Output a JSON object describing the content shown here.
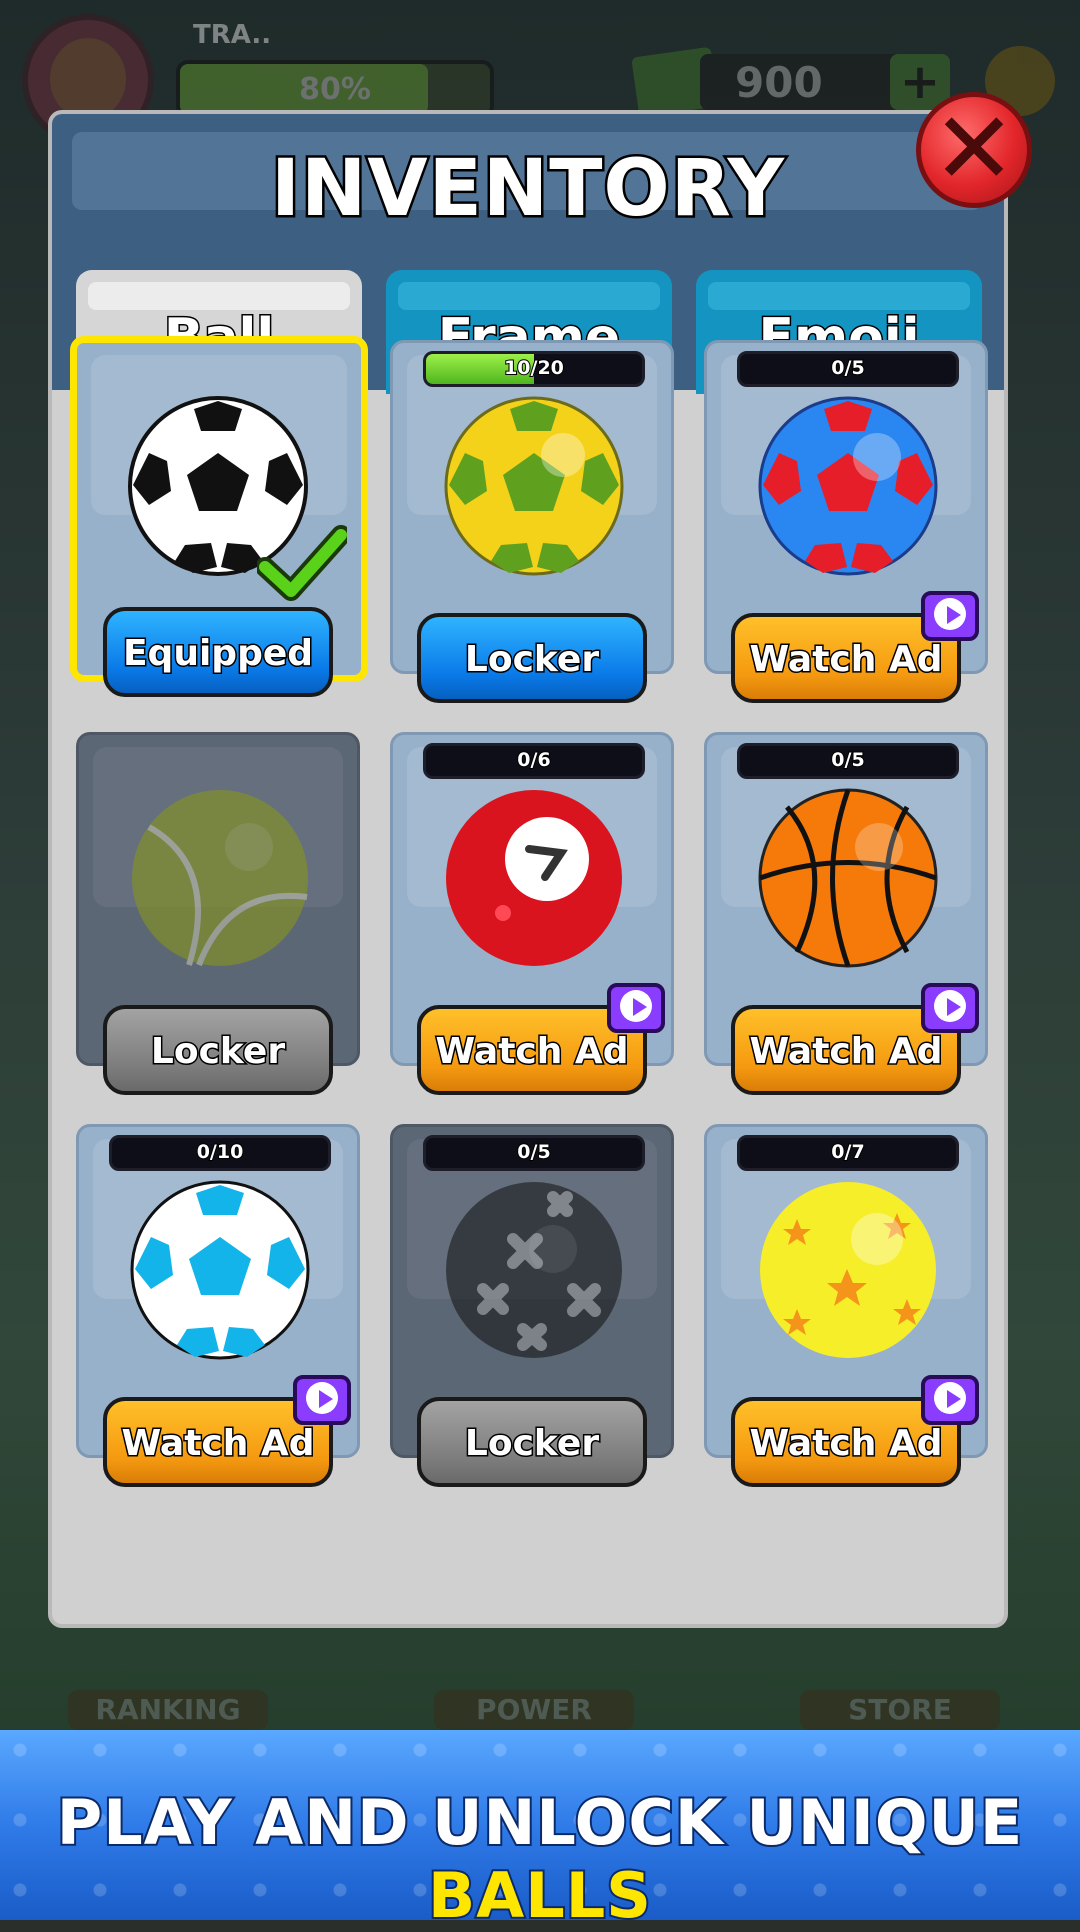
{
  "hud": {
    "player_name": "TRA..",
    "xp_percent_label": "80%",
    "xp_fraction": 0.8,
    "cash": "900",
    "plus_label": "+"
  },
  "bottom_nav": {
    "ranking": "RANKING",
    "power": "POWER",
    "store": "STORE"
  },
  "modal": {
    "title": "INVENTORY",
    "close_label": "✕",
    "tabs": {
      "ball": "Ball",
      "frame": "Frame",
      "emoji": "Emoji"
    },
    "selected_tab": "Ball"
  },
  "items": [
    {
      "name": "classic",
      "progress_label": "",
      "button": "Equipped",
      "button_style": "blue",
      "state": "equipped",
      "ad_icon": false
    },
    {
      "name": "brazil",
      "progress_label": "10/20",
      "progress_fraction": 0.5,
      "button": "Locker",
      "button_style": "blue",
      "state": "unlocked",
      "ad_icon": false
    },
    {
      "name": "red-blue",
      "progress_label": "0/5",
      "progress_fraction": 0,
      "button": "Watch Ad",
      "button_style": "orange",
      "state": "ad",
      "ad_icon": true
    },
    {
      "name": "tennis",
      "progress_label": "",
      "button": "Locker",
      "button_style": "gray",
      "state": "locked",
      "ad_icon": false
    },
    {
      "name": "billiard-7",
      "progress_label": "0/6",
      "progress_fraction": 0,
      "button": "Watch Ad",
      "button_style": "orange",
      "state": "ad",
      "ad_icon": true
    },
    {
      "name": "basketball",
      "progress_label": "0/5",
      "progress_fraction": 0,
      "button": "Watch Ad",
      "button_style": "orange",
      "state": "ad",
      "ad_icon": true
    },
    {
      "name": "cyan-soccer",
      "progress_label": "0/10",
      "progress_fraction": 0,
      "button": "Watch Ad",
      "button_style": "orange",
      "state": "ad",
      "ad_icon": true
    },
    {
      "name": "black-cross",
      "progress_label": "0/5",
      "progress_fraction": 0,
      "button": "Locker",
      "button_style": "gray",
      "state": "locked",
      "ad_icon": false
    },
    {
      "name": "yellow-stars",
      "progress_label": "0/7",
      "progress_fraction": 0,
      "button": "Watch Ad",
      "button_style": "orange",
      "state": "ad",
      "ad_icon": true
    }
  ],
  "banner": {
    "text_main": "PLAY AND UNLOCK UNIQUE ",
    "text_highlight": "BALLS"
  },
  "colors": {
    "modal_bg": "#d0d0d0",
    "header_blue": "#3d5f82",
    "tab_active": "#d6d6d6",
    "tab_inactive": "#1494c0",
    "selected_border": "#ffe600",
    "btn_blue": "#0a7ae8",
    "btn_orange": "#f59a10",
    "btn_gray": "#7d7d7d",
    "ad_badge": "#8a3cff",
    "progress_green": "#4fb51e"
  },
  "icons": {
    "close": "close-x-icon",
    "ad": "play-video-icon",
    "equipped": "checkmark-icon",
    "settings": "gear-icon",
    "cash": "banknote-icon"
  }
}
